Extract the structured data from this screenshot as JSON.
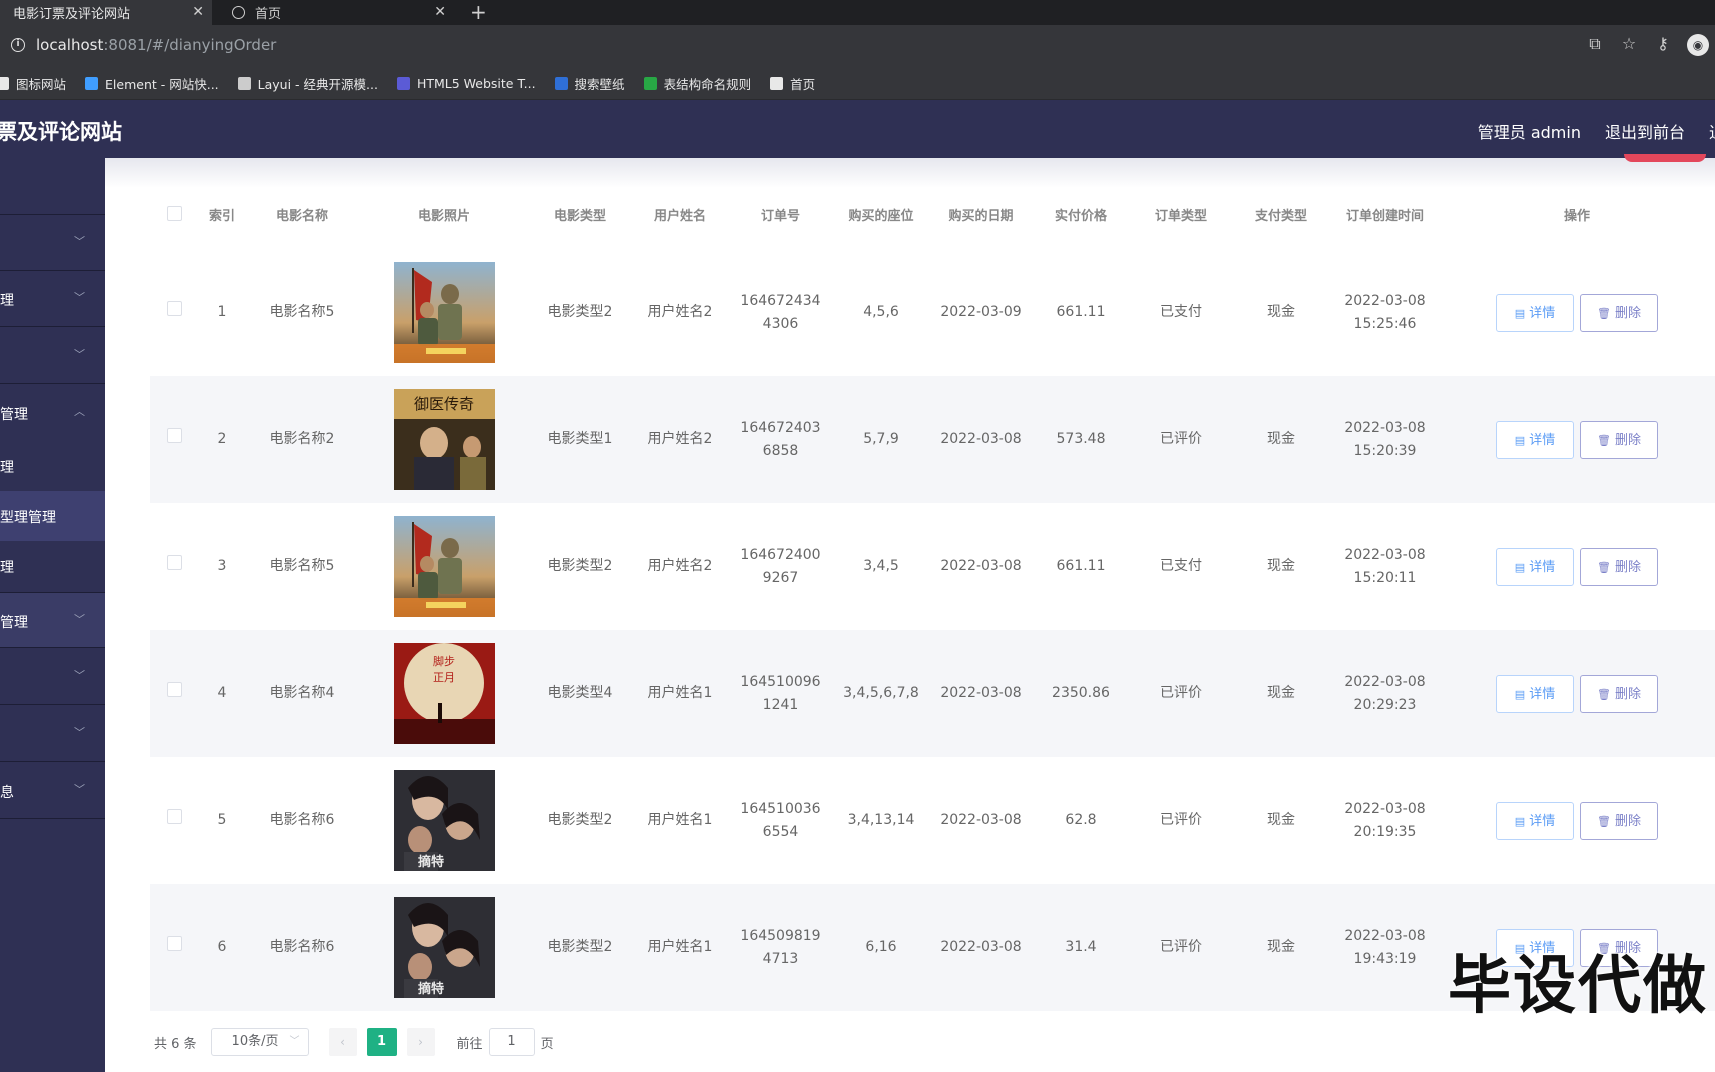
{
  "browser": {
    "active_tab": "电影订票及评论网站",
    "inactive_tab": "首页",
    "url_host": "localhost",
    "url_rest": ":8081/#/dianyingOrder",
    "bookmarks": [
      {
        "label": "图标网站",
        "color": "#e8e8e8"
      },
      {
        "label": "Element - 网站快...",
        "color": "#409eff"
      },
      {
        "label": "Layui - 经典开源模...",
        "color": "#cccccc"
      },
      {
        "label": "HTML5 Website T...",
        "color": "#5b5bd6"
      },
      {
        "label": "搜索壁纸",
        "color": "#2f6fd6"
      },
      {
        "label": "表结构命名规则",
        "color": "#28a745"
      },
      {
        "label": "首页",
        "color": "#e8e8e8"
      }
    ]
  },
  "header": {
    "site_title": "票及评论网站",
    "admin": "管理员 admin",
    "exit_front": "退出到前台"
  },
  "sidebar": {
    "items": [
      {
        "label": "",
        "expanded": false
      },
      {
        "label": "理",
        "expanded": false
      },
      {
        "label": "",
        "expanded": false
      },
      {
        "label": "管理",
        "expanded": true
      },
      {
        "label": "管理",
        "expanded": false
      },
      {
        "label": "",
        "expanded": false
      },
      {
        "label": "",
        "expanded": false
      },
      {
        "label": "息",
        "expanded": false
      }
    ],
    "subitems": [
      "理",
      "型理管理",
      "理"
    ]
  },
  "table": {
    "columns": [
      "索引",
      "电影名称",
      "电影照片",
      "电影类型",
      "用户姓名",
      "订单号",
      "购买的座位",
      "购买的日期",
      "实付价格",
      "订单类型",
      "支付类型",
      "订单创建时间",
      "操作"
    ],
    "detail_label": "详情",
    "delete_label": "删除",
    "rows": [
      {
        "index": "1",
        "movie": "电影名称5",
        "poster": "war",
        "type": "电影类型2",
        "user": "用户姓名2",
        "order_no": "1646724344306",
        "seats": "4,5,6",
        "date": "2022-03-09",
        "price": "661.11",
        "order_type": "已支付",
        "pay_type": "现金",
        "created": "2022-03-08 15:25:46"
      },
      {
        "index": "2",
        "movie": "电影名称2",
        "poster": "doctor",
        "type": "电影类型1",
        "user": "用户姓名2",
        "order_no": "1646724036858",
        "seats": "5,7,9",
        "date": "2022-03-08",
        "price": "573.48",
        "order_type": "已评价",
        "pay_type": "现金",
        "created": "2022-03-08 15:20:39"
      },
      {
        "index": "3",
        "movie": "电影名称5",
        "poster": "war",
        "type": "电影类型2",
        "user": "用户姓名2",
        "order_no": "1646724009267",
        "seats": "3,4,5",
        "date": "2022-03-08",
        "price": "661.11",
        "order_type": "已支付",
        "pay_type": "现金",
        "created": "2022-03-08 15:20:11"
      },
      {
        "index": "4",
        "movie": "电影名称4",
        "poster": "moon",
        "type": "电影类型4",
        "user": "用户姓名1",
        "order_no": "1645100961241",
        "seats": "3,4,5,6,7,8",
        "date": "2022-03-08",
        "price": "2350.86",
        "order_type": "已评价",
        "pay_type": "现金",
        "created": "2022-03-08 20:29:23"
      },
      {
        "index": "5",
        "movie": "电影名称6",
        "poster": "faces",
        "type": "电影类型2",
        "user": "用户姓名1",
        "order_no": "1645100366554",
        "seats": "3,4,13,14",
        "date": "2022-03-08",
        "price": "62.8",
        "order_type": "已评价",
        "pay_type": "现金",
        "created": "2022-03-08 20:19:35"
      },
      {
        "index": "6",
        "movie": "电影名称6",
        "poster": "faces",
        "type": "电影类型2",
        "user": "用户姓名1",
        "order_no": "1645098194713",
        "seats": "6,16",
        "date": "2022-03-08",
        "price": "31.4",
        "order_type": "已评价",
        "pay_type": "现金",
        "created": "2022-03-08 19:43:19"
      }
    ]
  },
  "pagination": {
    "total": "共 6 条",
    "page_size": "10条/页",
    "current": "1",
    "goto": "前往",
    "goto_value": "1",
    "page_unit": "页"
  },
  "watermark": "毕设代做"
}
